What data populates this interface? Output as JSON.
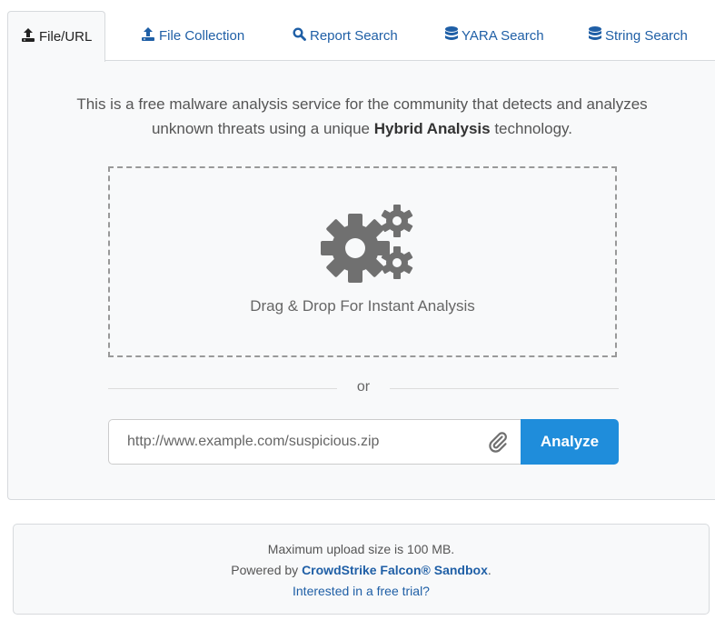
{
  "tabs": [
    {
      "label": "File/URL",
      "icon": "upload-icon",
      "active": true
    },
    {
      "label": "File Collection",
      "icon": "upload-icon",
      "active": false
    },
    {
      "label": "Report Search",
      "icon": "search-icon",
      "active": false
    },
    {
      "label": "YARA Search",
      "icon": "database-icon",
      "active": false
    },
    {
      "label": "String Search",
      "icon": "database-icon",
      "active": false
    }
  ],
  "intro": {
    "line1": "This is a free malware analysis service for the community that detects and analyzes",
    "line2_pre": "unknown threats using a unique ",
    "line2_bold": "Hybrid Analysis",
    "line2_post": " technology."
  },
  "dropzone": {
    "text": "Drag & Drop For Instant Analysis",
    "icon": "gears-icon"
  },
  "divider_text": "or",
  "url_input": {
    "placeholder": "http://www.example.com/suspicious.zip",
    "value": ""
  },
  "attach_icon": "paperclip-icon",
  "analyze_label": "Analyze",
  "info": {
    "line1": "Maximum upload size is 100 MB.",
    "line2_pre": "Powered by ",
    "line2_link": "CrowdStrike Falcon® Sandbox",
    "line2_post": ".",
    "line3_link": "Interested in a free trial?"
  },
  "colors": {
    "accent": "#1f8ddb",
    "link": "#1f5fa6",
    "icon_gray": "#707070"
  }
}
